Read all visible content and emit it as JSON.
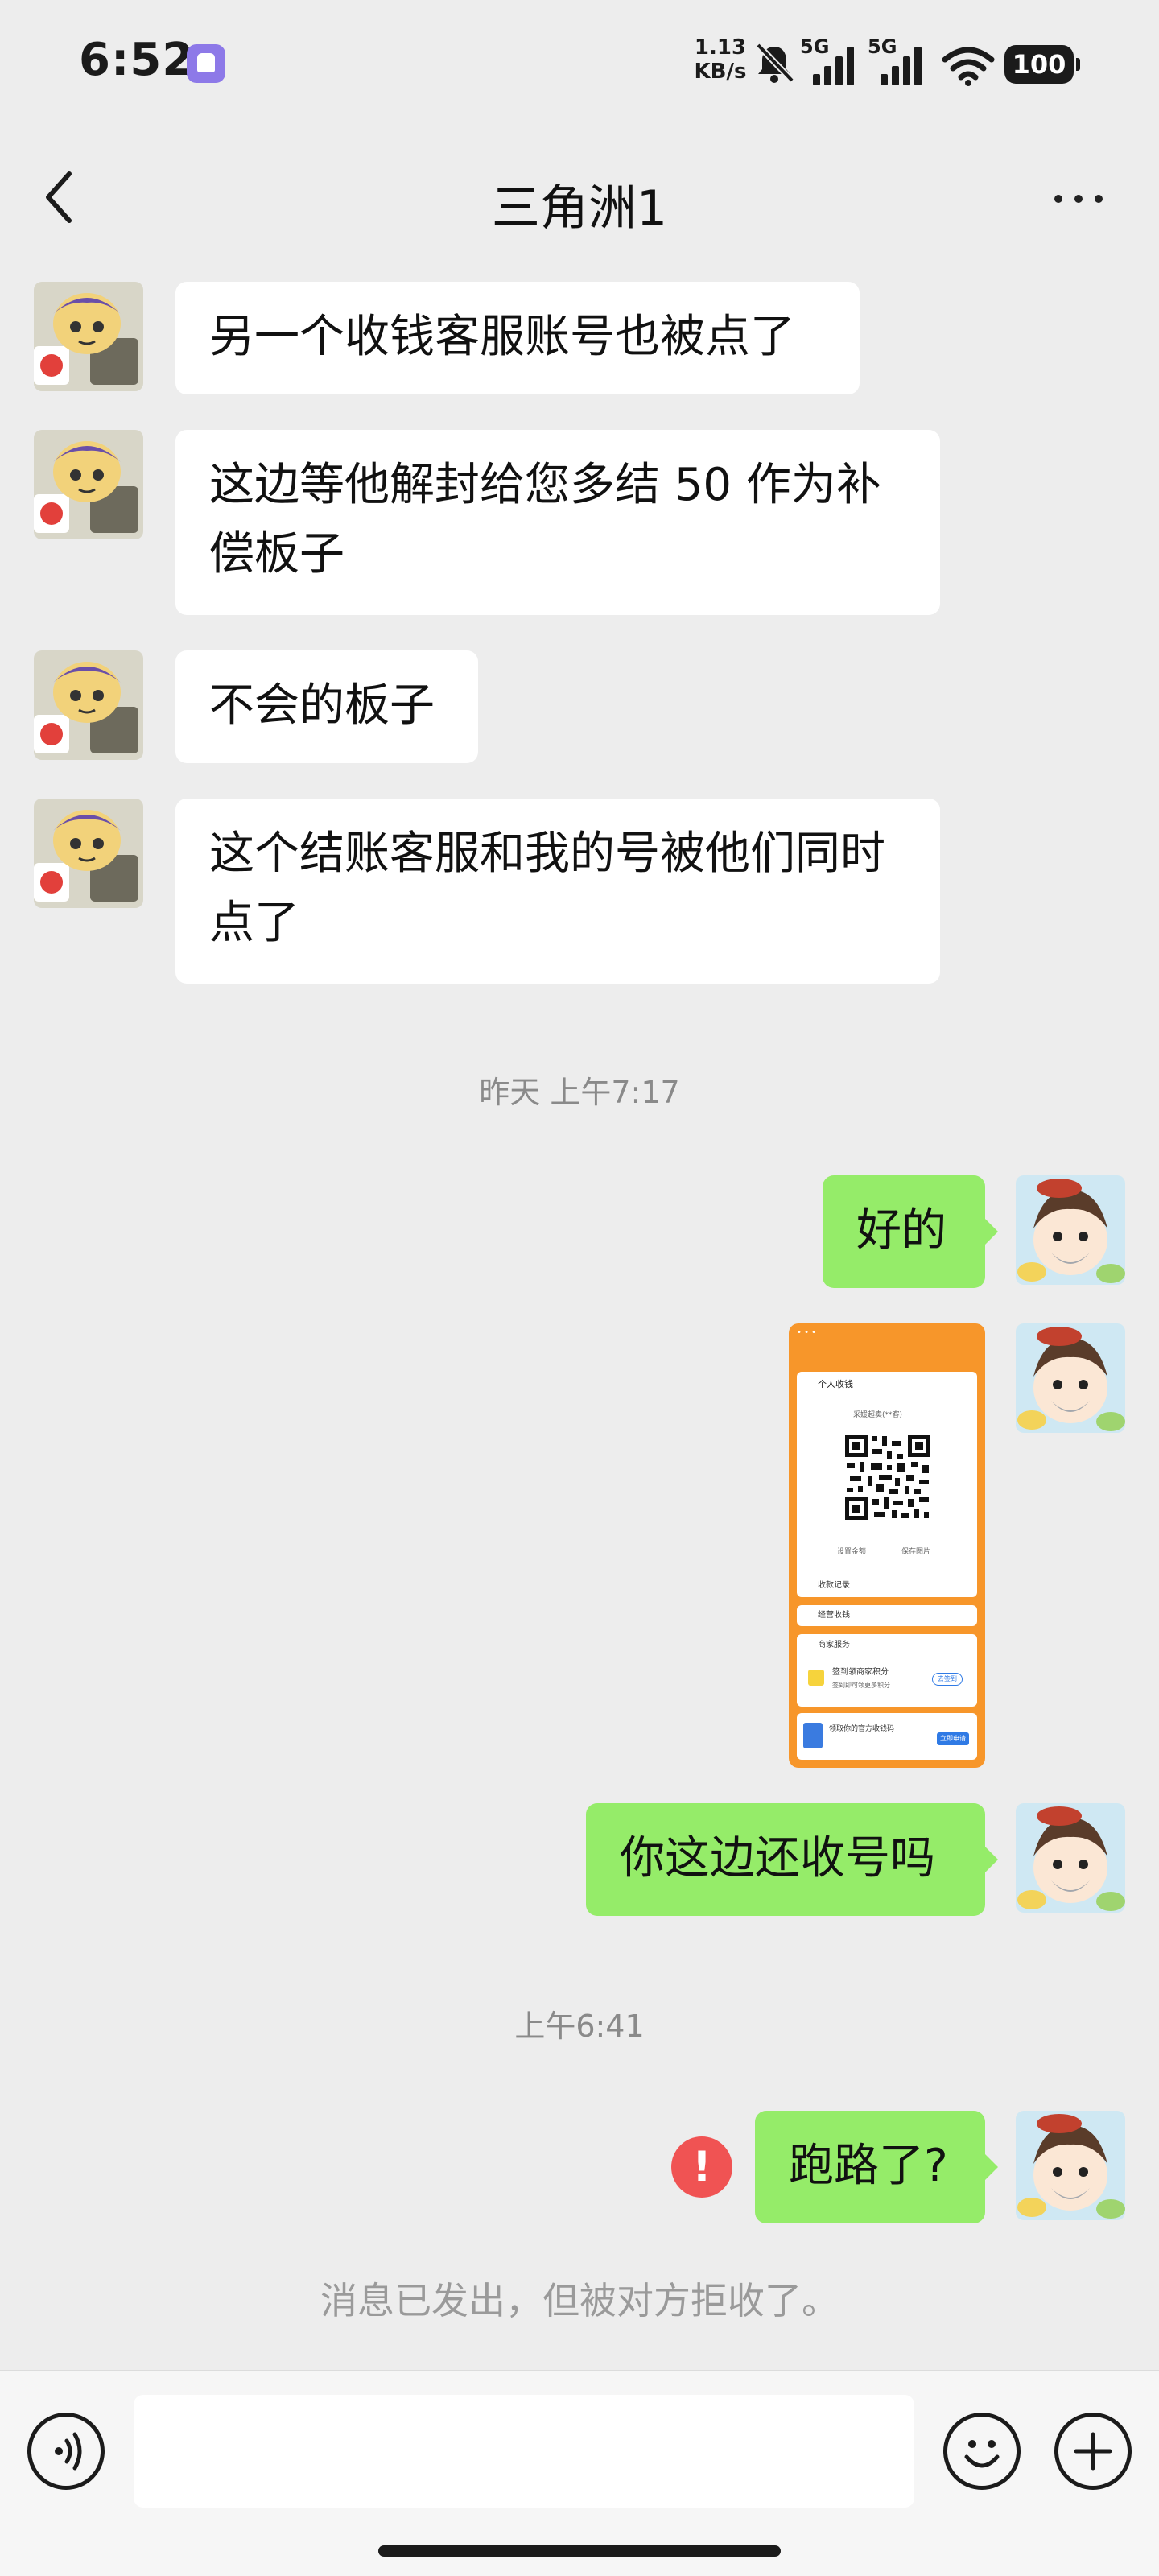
{
  "status_bar": {
    "time": "6:52",
    "net_speed_value": "1.13",
    "net_speed_unit": "KB/s",
    "signal_1": "5G",
    "signal_2": "5G",
    "battery": "100"
  },
  "header": {
    "title": "三角洲1"
  },
  "messages": [
    {
      "side": "left",
      "text": "另一个收钱客服账号也被点了"
    },
    {
      "side": "left",
      "text": "这边等他解封给您多结 50 作为补偿板子"
    },
    {
      "side": "left",
      "text": "不会的板子"
    },
    {
      "side": "left",
      "text": "这个结账客服和我的号被他们同时点了"
    },
    {
      "side": "right",
      "text": "好的"
    },
    {
      "side": "right",
      "text": "你这边还收号吗"
    },
    {
      "side": "right",
      "text": "跑路了?"
    }
  ],
  "timestamps": [
    "昨天 上午7:17",
    "上午6:41"
  ],
  "shared_image": {
    "heading": "个人收钱",
    "name_line": "采媛超卖(**客)",
    "qr_caption_left": "设置金额",
    "qr_caption_right": "保存图片",
    "row_records": "收款记录",
    "row_business": "经营收钱",
    "row_merchant": "商家服务",
    "points_title": "签到领商家积分",
    "points_sub": "签到即可领更多积分",
    "points_button": "去签到",
    "banner_title": "领取你的官方收钱码",
    "banner_button": "立即申请"
  },
  "error_mark": "!",
  "reject_note": "消息已发出，但被对方拒收了。",
  "input": {
    "value": "",
    "placeholder": ""
  },
  "colors": {
    "background": "#ededed",
    "bubble_self": "#95ec69",
    "bubble_other": "#ffffff",
    "error": "#f05353",
    "screenshot_orange": "#f7962a"
  }
}
